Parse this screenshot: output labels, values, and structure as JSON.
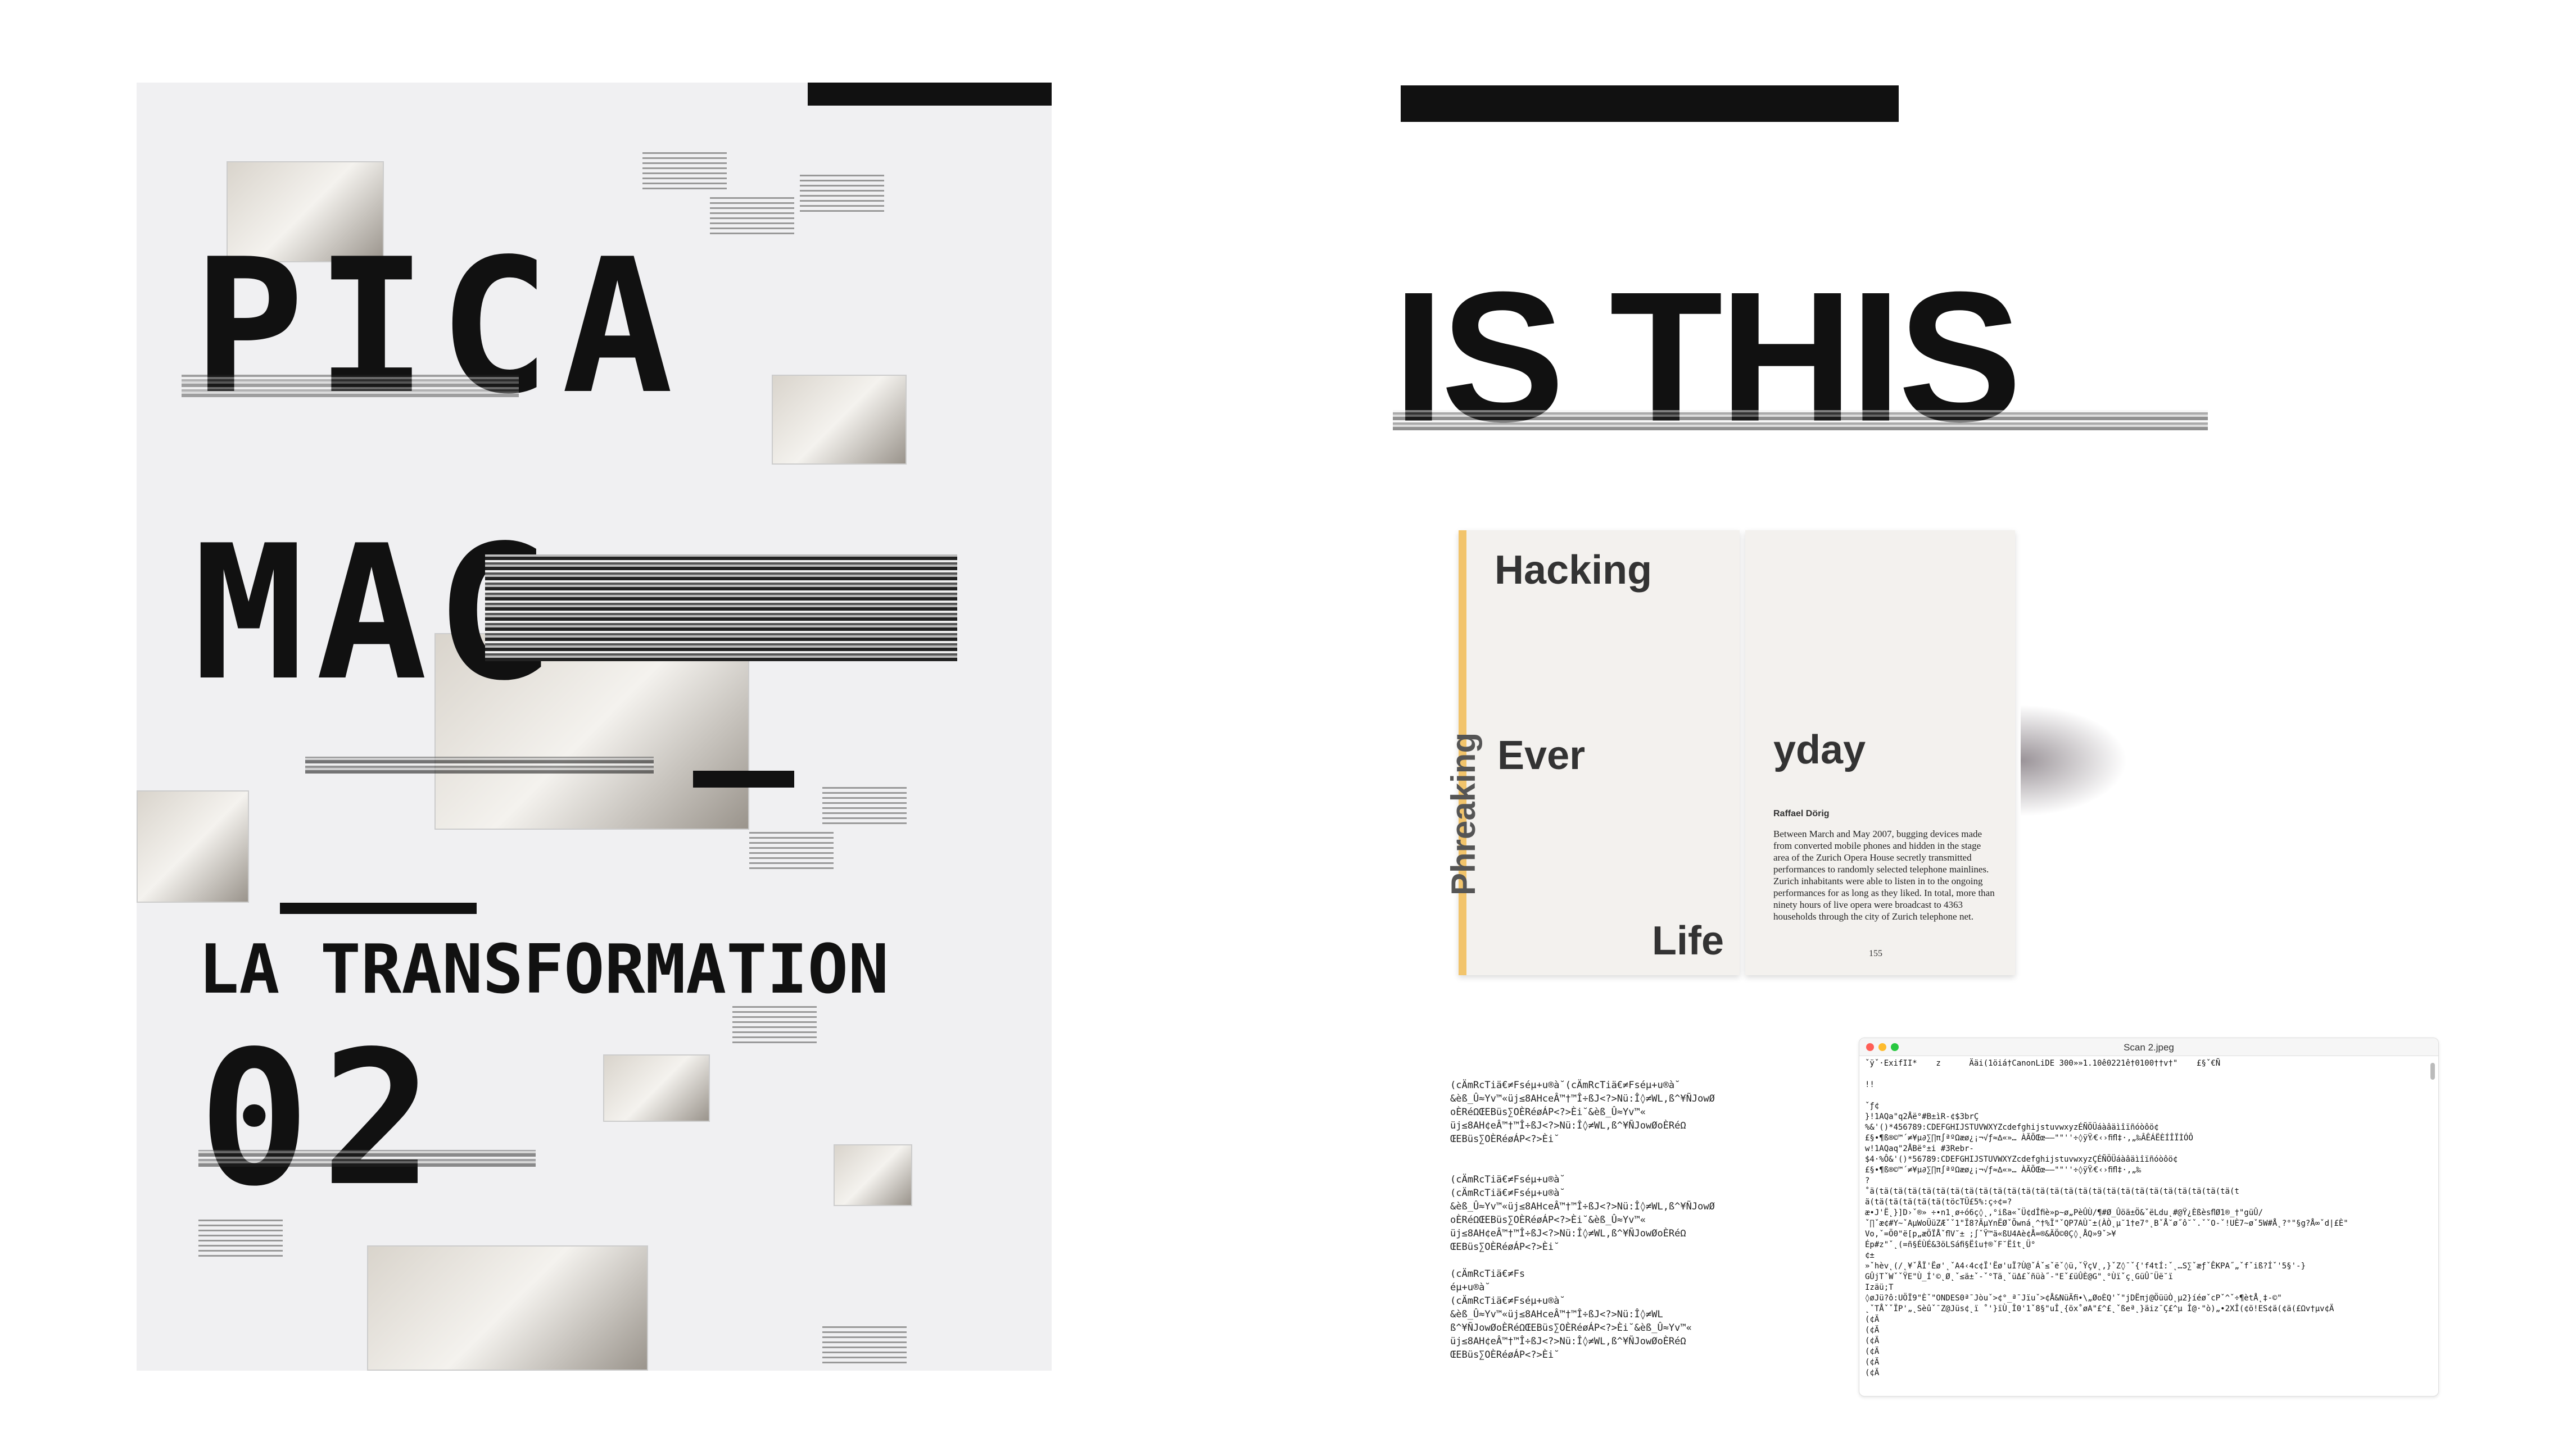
{
  "poster": {
    "title1": "PICA",
    "title2": "MAG",
    "subtitle": "LA TRANSFORMATION",
    "number": "02"
  },
  "right_panel": {
    "headline": "IS THIS"
  },
  "book": {
    "title_words": [
      "Hacking",
      "Ever",
      "yday",
      "Life"
    ],
    "spine": "Phreaking",
    "author": "Raffael Dörig",
    "body": "Between March and May 2007, bugging devices made from converted mobile phones and hidden in the stage area of the Zurich Opera House secretly transmitted performances to randomly selected telephone mainlines. Zurich inhabitants were able to listen in to the ongoing performances for as long as they liked. In total, more than ninety hours of live opera were broadcast to 4363 households through the city of Zurich telephone net.",
    "page_number": "155"
  },
  "garbled_text": [
    "(cÄmRcTiä€≠Fséµ+u®à˘(cÄmRcTiä€≠Fséµ+u®à˘",
    "&èß_Û≈Yv™«üj≤8AHceÂ™†™Î÷ßJ<?>Nü:Î◊≠WL,ß^¥ÑJowØ",
    "oÈRéΩŒEBüs∑OÈRéøÁP<?>Èi˘&èß_Û≈Yv™«",
    "üj≤8AH¢eÂ™†™Î÷ßJ<?>Nü:Î◊≠WL,ß^¥ÑJowØoÈRéΩ",
    "ŒEBüs∑OÈRéøÁP<?>Èi˘",
    "",
    "",
    "(cÄmRcTiä€≠Fséµ+u®à˘",
    "(cÄmRcTiä€≠Fséµ+u®à˘",
    "&èß_Û≈Yv™«üj≤8AHceÂ™†™Î÷ßJ<?>Nü:Î◊≠WL,ß^¥ÑJowØ",
    "oÈRéΩŒEBüs∑OÈRéøÁP<?>Èi˘&èß_Û≈Yv™«",
    "üj≤8AH¢eÂ™†™Î÷ßJ<?>Nü:Î◊≠WL,ß^¥ÑJowØoÈRéΩ",
    "ŒEBüs∑OÈRéøÁP<?>Èi˘",
    "",
    "(cÄmRcTiä€≠Fs",
    "éµ+u®à˘",
    "(cÄmRcTiä€≠Fséµ+u®à˘",
    "&èß_Û≈Yv™«üj≤8AHceÂ™†™Î÷ßJ<?>Nü:Î◊≠WL",
    "ß^¥ÑJowØoÈRéΩŒEBüs∑OÈRéøÁP<?>Èi˘&èß_Û≈Yv™«",
    "üj≤8AH¢eÂ™†™Î÷ßJ<?>Nü:Î◊≠WL,ß^¥ÑJowØoÈRéΩ",
    "ŒEBüs∑OÈRéøÁP<?>Èi˘"
  ],
  "scan_window": {
    "title": "Scan 2.jpeg",
    "lines": [
      "ˇÿˇ·ExifII*    z      Ääi(1öiá†CanonLiDE 300»»1.10ê0221ê†0100††v†\"    £§ˇ€Ñ",
      "",
      "!!",
      "",
      "ˇƒ¢",
      "}!1AQa\"q2Åë°#B±ìR-¢$3brÇ",
      "%&'()*456789:CDEFGHIJSTUVWXYZcdefghijstuvwxyzÉÑÖÜáàâäìîïñóòôö¢",
      "£§•¶ß®©™´≠¥µ∂∑∏π∫ªºΩæø¿¡¬√ƒ≈∆«»… ÀÃÕŒœ–—\"\"''÷◊ÿŸ⁄€‹›ﬁﬂ‡·‚„‰ÂÊÁËÈÍÎÏÌÓÔ",
      "w!1AQaq\"2ÅBë°±i #3Rebr-",
      "$4·%Ô&'()*56789:CDEFGHIJSTUVWXYZcdefghijstuvwxyzÇÉÑÖÜáàâäìîïñóòôö¢",
      "£§•¶ß®©™´≠¥µ∂∑∏π∫ªºΩæø¿¡¬√ƒ≈∆«»… ÀÃÕŒœ–—\"\"''÷◊ÿŸ⁄€‹›ﬁﬂ‡·‚„‰",
      "?",
      "˚ä(tä(tä(tä(tä(tä(tä(tä(tä(tä(tä(tä(tä(tä(tä(tä(tä(tä(tä(tä(tä(tä(tä(tä(tä(tä(t",
      "ä(tä(tä(tä(tä(tä(töcTÜ£5%:ç÷¢=?",
      "æ•J'Ë˛}]D›ˇ®» ÷•n1˛ø÷ó6ç◊˛,°ißa«ˇÜ¢dÎﬁè»p~ø„PèÛÙ/¶#Ø_Ûöä±Ö&ˇëLdu˛#@Ÿ¿ÈßèsﬂØ1®_†\"güÛ/",
      "ˇ∏ˇæ¢#Y~ˇAµWoÜüZÆˇˇ1\"Ï8?ÄµYnËØˇÕwná˛^†%Ï\"ˇQP7AÙ˘±(ÀÒ˛µ˘1†e7°˛BˇÅ˘ø˝ô˘ˇ.ˇˇO-ˇ!UÈ7~øˇ5W#Å˛?°\"§g?Å∞ˇd|£È\"",
      "Vo,ˇ=Ö0\"ë[p„æÖÏÅˇﬂV˘± ;∫ˇŸ™ä«ßU4Aè¢Å=®&ÄÖ©0Ç◊˛ÅQ»9ˇ>¥",
      "Ép#z\"ˇ˛(=ñ§ÉÙÉ&3öLSáﬁ§Ëîu†®ˇF˘Ëît˛Ü°",
      "¢±",
      "»ˇhèv˛(/˛¥ˇÅÏ'Ëø'˛ˇA4‹4c¢Ï'Ëø'uÏ?Ù@ˇÁˇ≤ˇëˇ◊ü,ˇŸçV˛,}ˇZ◊¯ˇ{'f4tÍ:ˇ˛…S∑ˇæƒˇÊKPA˝„ˇfˇiß?Íˇ'5§'-}",
      "GÛjTˇWˇˇŸE\"Ù_Í'©˛Ø˛ˇ≤ä±ˇ-ˇ°Tä˛ˇüΔ£ˇñüà˝-\"Eˇ£üÛÈ@G\"˛°Ùïˇç˛GüÛ¯Üë˘ï",
      "Izäü;T",
      "◊øJü?ô:UÖÏ9\"Èˇ\"ONDES0ª¯Jòuˇ>¢°_ª¯Jïuˇ>¢Å&NüÄﬁ•\\„ØoÈQ'ˇ\"jDËπj@ÖüüÒ˛µ2}íéøˇcPˇ^ˇ÷¶ètÅ˛‡-©\"",
      "˛ˇTÅˇˇÏP'„˛Sèûˇ¯Z@Jüs¢˛ï ˚'}ïÙ˛Î0'1ˇ8§\"uÎ˛{öx˚øA\"£^£˛ˇßeª˛}äiz¯Ç£^µ Î@·\"ò)„•2XÎ(¢ö!ES¢ä(¢ä(£Ωv†µv¢Ä",
      "(¢Ä",
      "(¢Ä",
      "(¢Ä",
      "(¢Ä",
      "(¢Ä",
      "(¢Ä"
    ]
  },
  "colors": {
    "accent_red": "#ff5f57",
    "accent_yellow": "#febc2e",
    "accent_green": "#28c840",
    "poster_bg": "#f0f0f2",
    "book_spine": "#f2c46b"
  }
}
